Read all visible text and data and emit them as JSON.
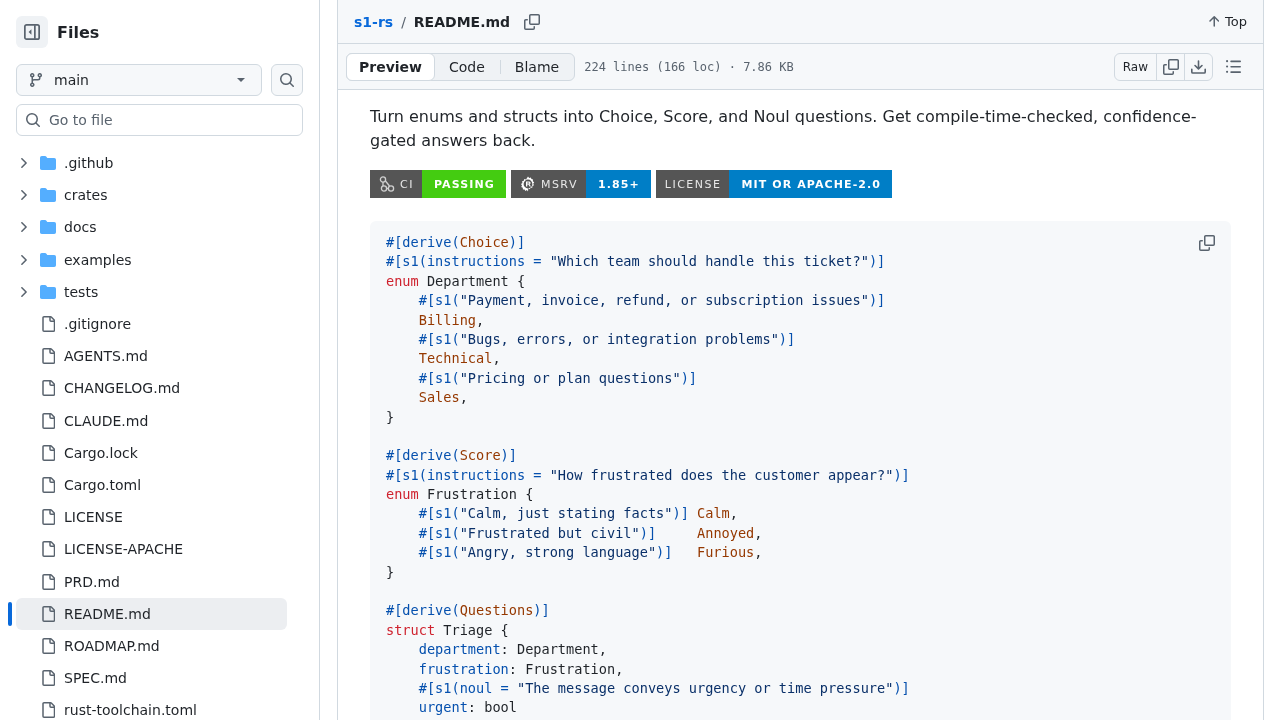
{
  "sidebar": {
    "title": "Files",
    "branch": "main",
    "search": {
      "placeholder": "Go to file"
    },
    "items": [
      {
        "name": ".github",
        "kind": "folder",
        "expanded": false,
        "selected": false
      },
      {
        "name": "crates",
        "kind": "folder",
        "expanded": false,
        "selected": false
      },
      {
        "name": "docs",
        "kind": "folder",
        "expanded": false,
        "selected": false
      },
      {
        "name": "examples",
        "kind": "folder",
        "expanded": false,
        "selected": false
      },
      {
        "name": "tests",
        "kind": "folder",
        "expanded": false,
        "selected": false
      },
      {
        "name": ".gitignore",
        "kind": "file",
        "selected": false
      },
      {
        "name": "AGENTS.md",
        "kind": "file",
        "selected": false
      },
      {
        "name": "CHANGELOG.md",
        "kind": "file",
        "selected": false
      },
      {
        "name": "CLAUDE.md",
        "kind": "file",
        "selected": false
      },
      {
        "name": "Cargo.lock",
        "kind": "file",
        "selected": false
      },
      {
        "name": "Cargo.toml",
        "kind": "file",
        "selected": false
      },
      {
        "name": "LICENSE",
        "kind": "file",
        "selected": false
      },
      {
        "name": "LICENSE-APACHE",
        "kind": "file",
        "selected": false
      },
      {
        "name": "PRD.md",
        "kind": "file",
        "selected": false
      },
      {
        "name": "README.md",
        "kind": "file",
        "selected": true
      },
      {
        "name": "ROADMAP.md",
        "kind": "file",
        "selected": false
      },
      {
        "name": "SPEC.md",
        "kind": "file",
        "selected": false
      },
      {
        "name": "rust-toolchain.toml",
        "kind": "file",
        "selected": false
      }
    ]
  },
  "file": {
    "repo": "s1-rs",
    "separator": "/",
    "name": "README.md",
    "top": "Top"
  },
  "toolbar": {
    "tabs": [
      {
        "label": "Preview",
        "selected": true
      },
      {
        "label": "Code",
        "selected": false
      },
      {
        "label": "Blame",
        "selected": false
      }
    ],
    "info": "224 lines (166 loc) · 7.86 KB",
    "raw": "Raw"
  },
  "readme": {
    "intro": "Turn enums and structs into Choice, Score, and Noul questions. Get compile-time-checked, confidence-gated answers back.",
    "badges": [
      {
        "kind": "ci",
        "label": "CI",
        "value": "PASSING",
        "color": "#44cc11"
      },
      {
        "kind": "msrv",
        "label": "MSRV",
        "value": "1.85+",
        "color": "#007ec6"
      },
      {
        "kind": "license",
        "label": "LICENSE",
        "value": "MIT OR APACHE-2.0",
        "color": "#007ec6"
      }
    ],
    "code": [
      [
        {
          "tokens": [
            {
              "kind": "meta",
              "text": "#[derive("
            },
            {
              "kind": "type",
              "text": "Choice"
            },
            {
              "kind": "meta",
              "text": ")]"
            }
          ]
        },
        {
          "tokens": [
            {
              "kind": "meta",
              "text": "#[s1(instructions = "
            },
            {
              "kind": "string",
              "text": "\"Which team should handle this ticket?\""
            },
            {
              "kind": "meta",
              "text": ")]"
            }
          ]
        },
        {
          "tokens": [
            {
              "kind": "keyword",
              "text": "enum"
            },
            {
              "kind": "plain",
              "text": " Department {"
            }
          ],
          "children": [
            {
              "tokens": [
                {
                  "kind": "meta",
                  "text": "#[s1("
                },
                {
                  "kind": "string",
                  "text": "\"Payment, invoice, refund, or subscription issues\""
                },
                {
                  "kind": "meta",
                  "text": ")]"
                }
              ]
            },
            {
              "tokens": [
                {
                  "kind": "type",
                  "text": "Billing"
                },
                {
                  "kind": "plain",
                  "text": ","
                }
              ]
            },
            {
              "tokens": [
                {
                  "kind": "meta",
                  "text": "#[s1("
                },
                {
                  "kind": "string",
                  "text": "\"Bugs, errors, or integration problems\""
                },
                {
                  "kind": "meta",
                  "text": ")]"
                }
              ]
            },
            {
              "tokens": [
                {
                  "kind": "type",
                  "text": "Technical"
                },
                {
                  "kind": "plain",
                  "text": ","
                }
              ]
            },
            {
              "tokens": [
                {
                  "kind": "meta",
                  "text": "#[s1("
                },
                {
                  "kind": "string",
                  "text": "\"Pricing or plan questions\""
                },
                {
                  "kind": "meta",
                  "text": ")]"
                }
              ]
            },
            {
              "tokens": [
                {
                  "kind": "type",
                  "text": "Sales"
                },
                {
                  "kind": "plain",
                  "text": ","
                }
              ]
            }
          ]
        },
        {
          "tokens": [
            {
              "kind": "plain",
              "text": "}"
            }
          ]
        }
      ],
      [
        {
          "tokens": [
            {
              "kind": "meta",
              "text": "#[derive("
            },
            {
              "kind": "type",
              "text": "Score"
            },
            {
              "kind": "meta",
              "text": ")]"
            }
          ]
        },
        {
          "tokens": [
            {
              "kind": "meta",
              "text": "#[s1(instructions = "
            },
            {
              "kind": "string",
              "text": "\"How frustrated does the customer appear?\""
            },
            {
              "kind": "meta",
              "text": ")]"
            }
          ]
        },
        {
          "tokens": [
            {
              "kind": "keyword",
              "text": "enum"
            },
            {
              "kind": "plain",
              "text": " Frustration {"
            }
          ],
          "children": [
            {
              "tokens": [
                {
                  "kind": "meta",
                  "text": "#[s1("
                },
                {
                  "kind": "string",
                  "text": "\"Calm, just stating facts\""
                },
                {
                  "kind": "meta",
                  "text": ")]"
                },
                {
                  "kind": "type",
                  "text": " Calm"
                },
                {
                  "kind": "plain",
                  "text": ","
                }
              ]
            },
            {
              "tokens": [
                {
                  "kind": "meta",
                  "text": "#[s1("
                },
                {
                  "kind": "string",
                  "text": "\"Frustrated but civil\""
                },
                {
                  "kind": "meta",
                  "text": ")]"
                },
                {
                  "kind": "type",
                  "text": "     Annoyed"
                },
                {
                  "kind": "plain",
                  "text": ","
                }
              ]
            },
            {
              "tokens": [
                {
                  "kind": "meta",
                  "text": "#[s1("
                },
                {
                  "kind": "string",
                  "text": "\"Angry, strong language\""
                },
                {
                  "kind": "meta",
                  "text": ")]"
                },
                {
                  "kind": "type",
                  "text": "   Furious"
                },
                {
                  "kind": "plain",
                  "text": ","
                }
              ]
            }
          ]
        },
        {
          "tokens": [
            {
              "kind": "plain",
              "text": "}"
            }
          ]
        }
      ],
      [
        {
          "tokens": [
            {
              "kind": "meta",
              "text": "#[derive("
            },
            {
              "kind": "type",
              "text": "Questions"
            },
            {
              "kind": "meta",
              "text": ")]"
            }
          ]
        },
        {
          "tokens": [
            {
              "kind": "keyword",
              "text": "struct"
            },
            {
              "kind": "plain",
              "text": " Triage {"
            }
          ],
          "children": [
            {
              "tokens": [
                {
                  "kind": "property",
                  "text": "department"
                },
                {
                  "kind": "plain",
                  "text": ": Department,"
                }
              ]
            },
            {
              "tokens": [
                {
                  "kind": "property",
                  "text": "frustration"
                },
                {
                  "kind": "plain",
                  "text": ": Frustration,"
                }
              ]
            },
            {
              "tokens": [
                {
                  "kind": "meta",
                  "text": "#[s1(noul = "
                },
                {
                  "kind": "string",
                  "text": "\"The message conveys urgency or time pressure\""
                },
                {
                  "kind": "meta",
                  "text": ")]"
                }
              ]
            },
            {
              "tokens": [
                {
                  "kind": "property",
                  "text": "urgent"
                },
                {
                  "kind": "plain",
                  "text": ": bool"
                }
              ]
            }
          ]
        }
      ]
    ]
  }
}
